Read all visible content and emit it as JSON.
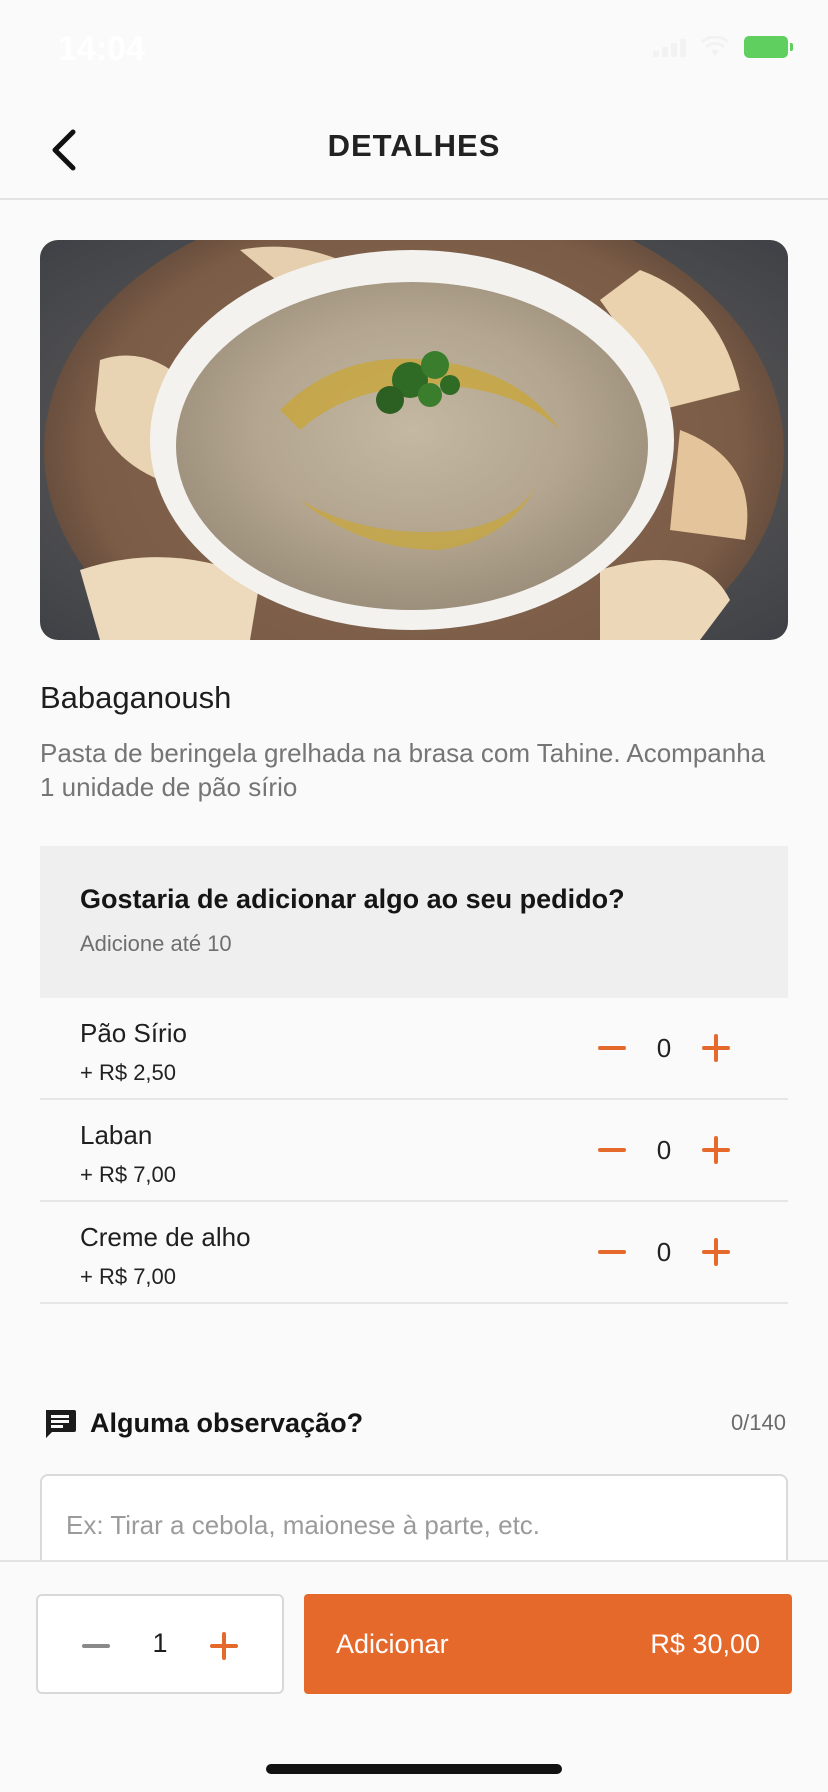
{
  "status_bar": {
    "time": "14:04"
  },
  "nav": {
    "title": "DETALHES",
    "back_icon": "chevron-left-icon"
  },
  "product": {
    "image_icon": "babaganoush-photo",
    "name": "Babaganoush",
    "description": "Pasta de beringela grelhada na brasa com Tahine. Acompanha 1 unidade de pão sírio"
  },
  "addons": {
    "title": "Gostaria de adicionar algo ao seu pedido?",
    "subtitle": "Adicione até 10",
    "items": [
      {
        "name": "Pão Sírio",
        "price": "+ R$ 2,50",
        "count": "0"
      },
      {
        "name": "Laban",
        "price": "+ R$ 7,00",
        "count": "0"
      },
      {
        "name": "Creme de alho",
        "price": "+ R$ 7,00",
        "count": "0"
      }
    ]
  },
  "observation": {
    "label": "Alguma observação?",
    "counter": "0/140",
    "placeholder": "Ex: Tirar a cebola, maionese à parte, etc.",
    "icon": "comment-icon"
  },
  "footer": {
    "quantity": "1",
    "add_label": "Adicionar",
    "total": "R$ 30,00"
  },
  "colors": {
    "accent": "#e6692c",
    "battery": "#5fcf5f"
  }
}
